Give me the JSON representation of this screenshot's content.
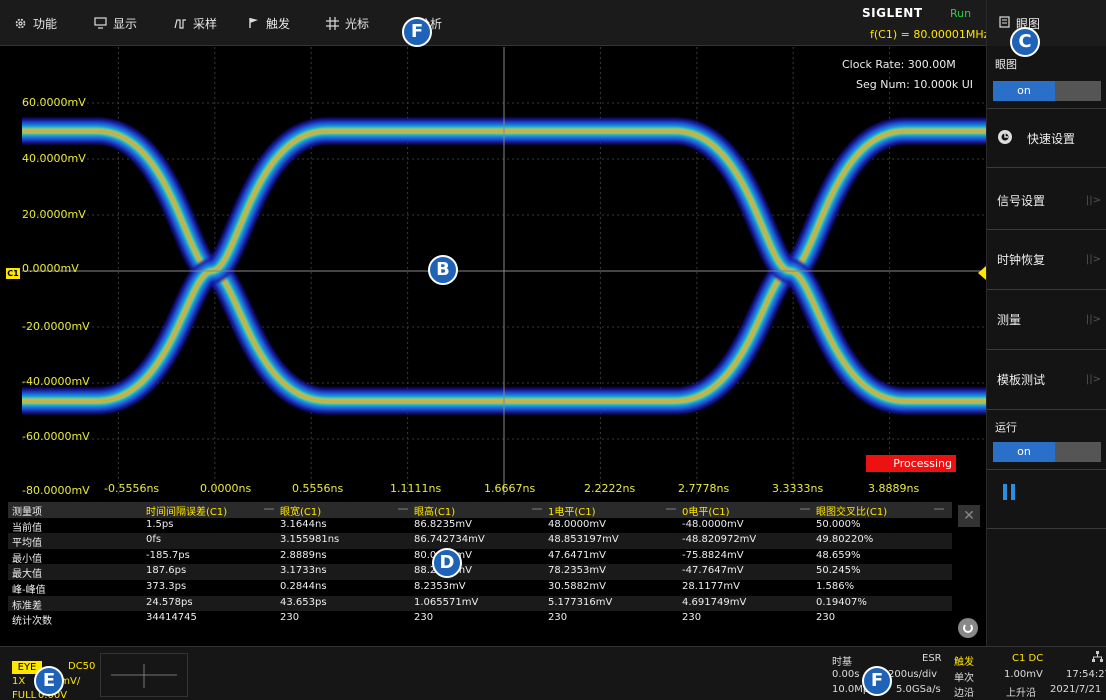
{
  "menu": {
    "items": [
      {
        "label": "功能",
        "icon": "gear-icon"
      },
      {
        "label": "显示",
        "icon": "display-icon"
      },
      {
        "label": "采样",
        "icon": "acquire-icon"
      },
      {
        "label": "触发",
        "icon": "flag-icon"
      },
      {
        "label": "光标",
        "icon": "cursor-icon"
      },
      {
        "label": "分析",
        "icon": "analysis-icon"
      }
    ]
  },
  "brand": {
    "logo": "SIGLENT",
    "status": "Run",
    "freq": "f(C1) = 80.00001MHz"
  },
  "right_panel": {
    "title": "眼图",
    "eye_label": "眼图",
    "eye_toggle": "on",
    "quick_setup": "快速设置",
    "buttons": [
      "信号设置",
      "时钟恢复",
      "测量",
      "模板测试"
    ],
    "run_label": "运行",
    "run_toggle": "on"
  },
  "scope": {
    "clock_rate": "Clock Rate: 300.00M",
    "seg_num": "Seg Num: 10.000k UI",
    "processing": "Processing",
    "y_labels": [
      "60.0000mV",
      "40.0000mV",
      "20.0000mV",
      "0.0000mV",
      "-20.0000mV",
      "-40.0000mV",
      "-60.0000mV",
      "-80.0000mV"
    ],
    "x_labels": [
      "-0.5556ns",
      "0.0000ns",
      "0.5556ns",
      "1.1111ns",
      "1.6667ns",
      "2.2222ns",
      "2.7778ns",
      "3.3333ns",
      "3.8889ns"
    ],
    "channel_marker": "C1"
  },
  "measurements": {
    "headers": [
      "测量项",
      "时间间隔误差(C1)",
      "眼宽(C1)",
      "眼高(C1)",
      "1电平(C1)",
      "0电平(C1)",
      "眼图交叉比(C1)"
    ],
    "rows": [
      [
        "当前值",
        "1.5ps",
        "3.1644ns",
        "86.8235mV",
        "48.0000mV",
        "-48.0000mV",
        "50.000%"
      ],
      [
        "平均值",
        "0fs",
        "3.155981ns",
        "86.742734mV",
        "48.853197mV",
        "-48.820972mV",
        "49.80220%"
      ],
      [
        "最小值",
        "-185.7ps",
        "2.8889ns",
        "80.0000mV",
        "47.6471mV",
        "-75.8824mV",
        "48.659%"
      ],
      [
        "最大值",
        "187.6ps",
        "3.1733ns",
        "88.2353mV",
        "78.2353mV",
        "-47.7647mV",
        "50.245%"
      ],
      [
        "峰-峰值",
        "373.3ps",
        "0.2844ns",
        "8.2353mV",
        "30.5882mV",
        "28.1177mV",
        "1.586%"
      ],
      [
        "标准差",
        "24.578ps",
        "43.653ps",
        "1.065571mV",
        "5.177316mV",
        "4.691749mV",
        "0.19407%"
      ],
      [
        "统计次数",
        "34414745",
        "230",
        "230",
        "230",
        "230",
        "230"
      ]
    ]
  },
  "bottom": {
    "eye_tag": "EYE",
    "coupling": "DC50",
    "probe": "1X",
    "vdiv": "20.0mV/",
    "bw": "FULL",
    "offset": "0.00V",
    "timebase_label": "时基",
    "esr": "ESR",
    "delay": "0.00s",
    "tdiv": "200us/div",
    "mem": "10.0Mpts",
    "srate": "5.0GSa/s",
    "trigger_label": "触发",
    "trigger_source": "C1 DC",
    "trigger_mode": "单次",
    "trigger_level": "1.00mV",
    "trigger_type": "边沿",
    "trigger_slope": "上升沿",
    "time": "17:54:27",
    "date": "2021/7/21"
  },
  "callouts": [
    "F",
    "B",
    "C",
    "D",
    "E",
    "F"
  ],
  "colors": {
    "accent_yellow": "#ffe600",
    "run_green": "#2ecc40",
    "toggle_blue": "#2a70c8",
    "processing_red": "#ee1111"
  }
}
